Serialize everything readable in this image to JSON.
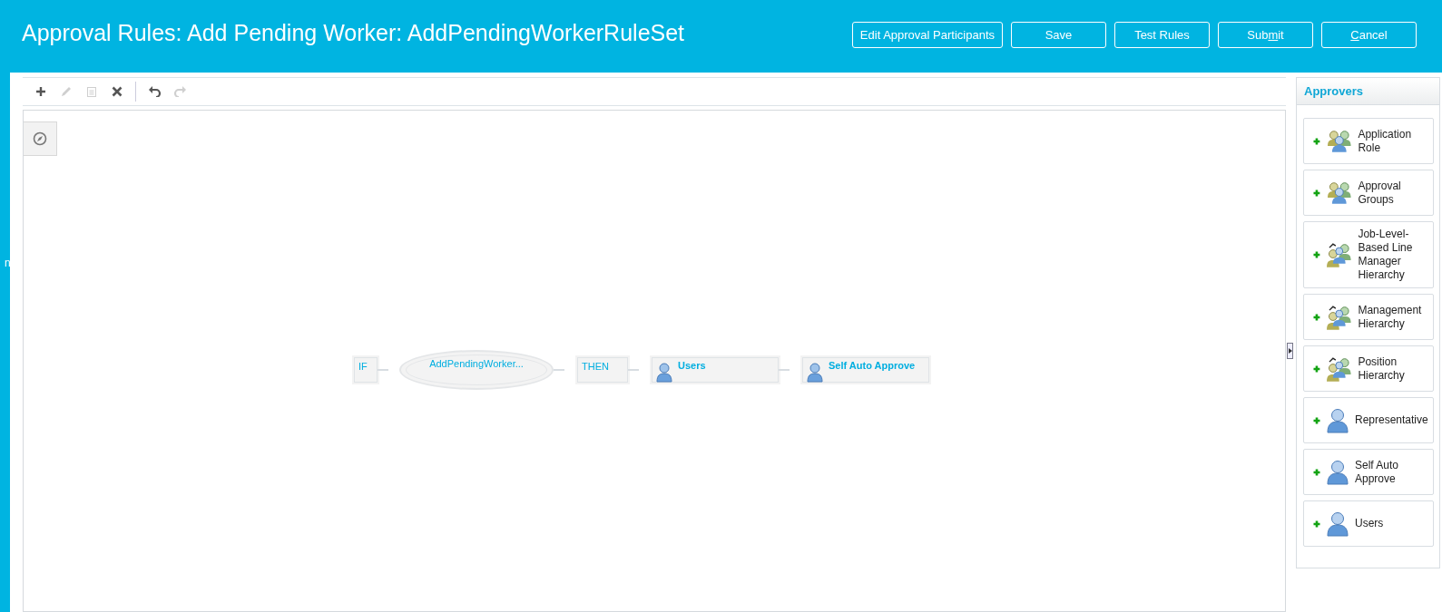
{
  "header": {
    "title": "Approval Rules: Add Pending Worker: AddPendingWorkerRuleSet",
    "buttons": [
      {
        "text_before": "Edit Approval Participants"
      },
      {
        "text_before": "Save"
      },
      {
        "text_before": "Test Rules"
      },
      {
        "text_before": "Sub",
        "access_key": "m",
        "text_after": "it"
      },
      {
        "access_key": "C",
        "text_after": "ancel"
      }
    ]
  },
  "left_strip": {
    "text": "n"
  },
  "toolbar": {
    "tools": [
      {
        "kind": "add",
        "disabled": false
      },
      {
        "kind": "edit",
        "disabled": true
      },
      {
        "kind": "copy",
        "disabled": true
      },
      {
        "kind": "delete",
        "disabled": false
      },
      {
        "kind": "undo",
        "disabled": false
      },
      {
        "kind": "redo",
        "disabled": true
      }
    ]
  },
  "diagram": {
    "nodes": [
      {
        "kind": "if",
        "label": "IF"
      },
      {
        "kind": "condition",
        "label": "AddPendingWorker..."
      },
      {
        "kind": "then",
        "label": "THEN"
      },
      {
        "kind": "approver",
        "label": "Users"
      },
      {
        "kind": "approver",
        "label": "Self Auto Approve"
      }
    ]
  },
  "approvers": {
    "title": "Approvers",
    "items": [
      {
        "kind": "group",
        "label": "Application Role"
      },
      {
        "kind": "group",
        "label": "Approval Groups"
      },
      {
        "kind": "hierarchy",
        "label": "Job-Level-Based Line Manager Hierarchy"
      },
      {
        "kind": "hierarchy",
        "label": "Management Hierarchy"
      },
      {
        "kind": "hierarchy",
        "label": "Position Hierarchy"
      },
      {
        "kind": "person",
        "label": "Representative"
      },
      {
        "kind": "person",
        "label": "Self Auto Approve"
      },
      {
        "kind": "person",
        "label": "Users"
      }
    ]
  }
}
